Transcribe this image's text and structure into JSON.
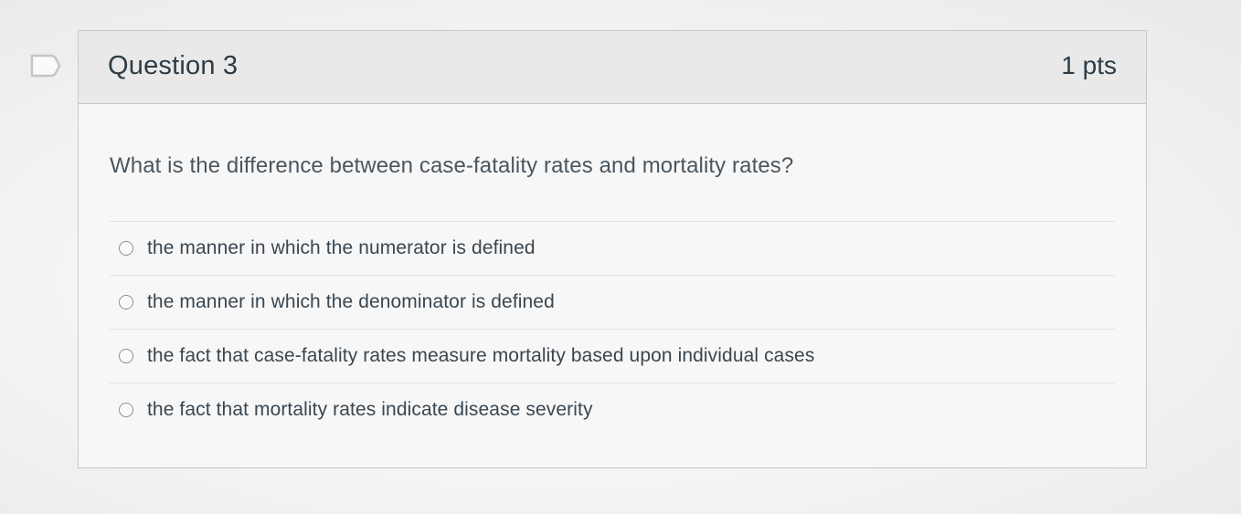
{
  "flag": {
    "icon": "flag-icon"
  },
  "question": {
    "title": "Question 3",
    "points": "1 pts",
    "text": "What is the difference between case-fatality rates and mortality rates?",
    "answers": [
      {
        "label": "the manner in which the numerator is defined",
        "selected": false
      },
      {
        "label": "the manner in which the denominator is defined",
        "selected": false
      },
      {
        "label": "the fact that case-fatality rates measure mortality based upon individual cases",
        "selected": false
      },
      {
        "label": "the fact that mortality rates indicate disease severity",
        "selected": false
      }
    ]
  }
}
